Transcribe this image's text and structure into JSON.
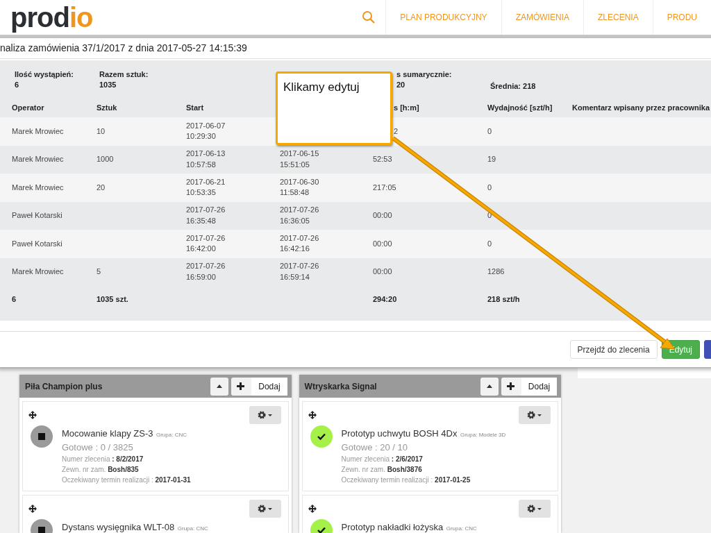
{
  "logo": "prodio",
  "nav": {
    "items": [
      "PLAN PRODUKCYJNY",
      "ZAMÓWIENIA",
      "ZLECENIA",
      "PRODU"
    ]
  },
  "modal": {
    "title": "naliza zamówienia 37/1/2017 z dnia 2017-05-27 14:15:39",
    "summary": [
      {
        "label": "Ilość wystąpień:",
        "value": "6"
      },
      {
        "label": "Razem sztuk:",
        "value": "1035"
      },
      {
        "label": "s sumarycznie:",
        "value": "20"
      },
      {
        "label": "Średnia: 218"
      }
    ],
    "columns": {
      "operator": "Operator",
      "count": "Sztuk",
      "start": "Start",
      "time": "s [h:m]",
      "rate": "Wydajność [szt/h]",
      "comment": "Komentarz wpisany przez pracownika"
    },
    "rows": [
      {
        "operator": "Marek Mrowiec",
        "count": "10",
        "start": [
          "2017-06-07",
          "10:29:30"
        ],
        "time": "2",
        "rate": "0"
      },
      {
        "operator": "Marek Mrowiec",
        "count": "1000",
        "start": [
          "2017-06-13",
          "10:57:58"
        ],
        "end": [
          "2017-06-15",
          "15:51:05"
        ],
        "time": "52:53",
        "rate": "19"
      },
      {
        "operator": "Marek Mrowiec",
        "count": "20",
        "start": [
          "2017-06-21",
          "10:53:35"
        ],
        "end": [
          "2017-06-30",
          "11:58:48"
        ],
        "time": "217:05",
        "rate": "0"
      },
      {
        "operator": "Paweł Kotarski",
        "start": [
          "2017-07-26",
          "16:35:48"
        ],
        "end": [
          "2017-07-26",
          "16:36:05"
        ],
        "time": "00:00",
        "rate": "0"
      },
      {
        "operator": "Paweł Kotarski",
        "start": [
          "2017-07-26",
          "16:42:00"
        ],
        "end": [
          "2017-07-26",
          "16:42:16"
        ],
        "time": "00:00",
        "rate": "0"
      },
      {
        "operator": "Marek Mrowiec",
        "count": "5",
        "start": [
          "2017-07-26",
          "16:59:00"
        ],
        "end": [
          "2017-07-26",
          "16:59:14"
        ],
        "time": "00:00",
        "rate": "1286"
      }
    ],
    "totals": {
      "operator": "6",
      "count": "1035 szt.",
      "time": "294:20",
      "rate": "218 szt/h"
    },
    "buttons": [
      "Przejdź do zlecenia",
      "Edytuj"
    ]
  },
  "callout": "Klikamy edytuj",
  "boards": [
    {
      "title": "Piła Champion plus",
      "add": "Dodaj",
      "cards": [
        {
          "kind": "stopped",
          "name": "Mocowanie klapy ZS-3",
          "group": "Grupa: CNC",
          "progress": "Gotowe : 0 / 3825",
          "fields": [
            {
              "label": "Numer zlecenia",
              "value": ": 8/2/2017"
            },
            {
              "label": "Zewn. nr zam.",
              "value": "Bosh/835"
            },
            {
              "label": "Oczekiwany termin realizacji :",
              "value": "2017-01-31"
            }
          ]
        },
        {
          "kind": "stopped",
          "name": "Dystans wysięgnika WLT-08",
          "group": "Grupa: CNC"
        }
      ]
    },
    {
      "title": "Wtryskarka Signal",
      "add": "Dodaj",
      "cards": [
        {
          "kind": "done",
          "name": "Prototyp uchwytu BOSH 4Dx",
          "group": "Grupa: Modele 3D",
          "progress": "Gotowe : 20 / 10",
          "fields": [
            {
              "label": "Numer zlecenia",
              "value": ": 2/6/2017"
            },
            {
              "label": "Zewn. nr zam.",
              "value": "Bosh/3876"
            },
            {
              "label": "Oczekiwany termin realizacji :",
              "value": "2017-01-25"
            }
          ]
        },
        {
          "kind": "done",
          "name": "Prototyp nakładki łożyska",
          "group": "Grupa: CNC"
        }
      ]
    }
  ]
}
